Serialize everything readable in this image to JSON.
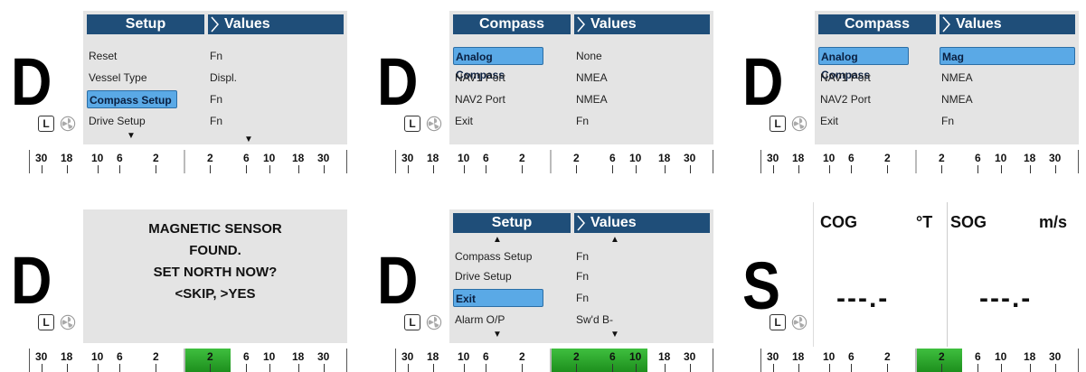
{
  "panels": [
    {
      "mode": "D",
      "left_header": "Setup",
      "right_header": "Values",
      "rows": [
        {
          "label": "Reset",
          "value": "Fn"
        },
        {
          "label": "Vessel Type",
          "value": "Displ."
        },
        {
          "label": "Compass Setup",
          "value": "Fn",
          "selected": "label"
        },
        {
          "label": "Drive Setup",
          "value": "Fn"
        }
      ]
    },
    {
      "mode": "D",
      "left_header": "Compass",
      "right_header": "Values",
      "rows": [
        {
          "label": "Analog Compass",
          "value": "None",
          "selected": "label"
        },
        {
          "label": "NAV1 Port",
          "value": "NMEA"
        },
        {
          "label": "NAV2 Port",
          "value": "NMEA"
        },
        {
          "label": "Exit",
          "value": "Fn"
        }
      ]
    },
    {
      "mode": "D",
      "left_header": "Compass",
      "right_header": "Values",
      "rows": [
        {
          "label": "Analog Compass",
          "value": "Mag",
          "selected": "both"
        },
        {
          "label": "NAV1 Port",
          "value": "NMEA"
        },
        {
          "label": "NAV2 Port",
          "value": "NMEA"
        },
        {
          "label": "Exit",
          "value": "Fn"
        }
      ]
    },
    {
      "mode": "D",
      "message": [
        "MAGNETIC SENSOR",
        "FOUND.",
        "SET NORTH NOW?",
        "<SKIP, >YES"
      ]
    },
    {
      "mode": "D",
      "left_header": "Setup",
      "right_header": "Values",
      "rows": [
        {
          "label": "Compass Setup",
          "value": "Fn"
        },
        {
          "label": "Drive Setup",
          "value": "Fn"
        },
        {
          "label": "Exit",
          "value": "Fn",
          "selected": "label"
        },
        {
          "label": "Alarm O/P",
          "value": "Sw'd B-"
        }
      ]
    },
    {
      "mode": "S",
      "cog_label": "COG",
      "cog_unit": "°T",
      "cog_value": "---.-",
      "sog_label": "SOG",
      "sog_unit": "m/s",
      "sog_value": "---.-"
    }
  ],
  "lock_label": "L",
  "scale_labels": [
    "30",
    "18",
    "10",
    "6",
    "2",
    "2",
    "6",
    "10",
    "18",
    "30"
  ],
  "colors": {
    "header": "#1f4e79",
    "selected": "#5aa9e6",
    "menu_bg": "#e4e4e4",
    "indicator": "#2aa52a"
  },
  "icons": [
    "fan-icon",
    "up-arrow-icon",
    "down-arrow-icon",
    "chevron-right-icon"
  ]
}
